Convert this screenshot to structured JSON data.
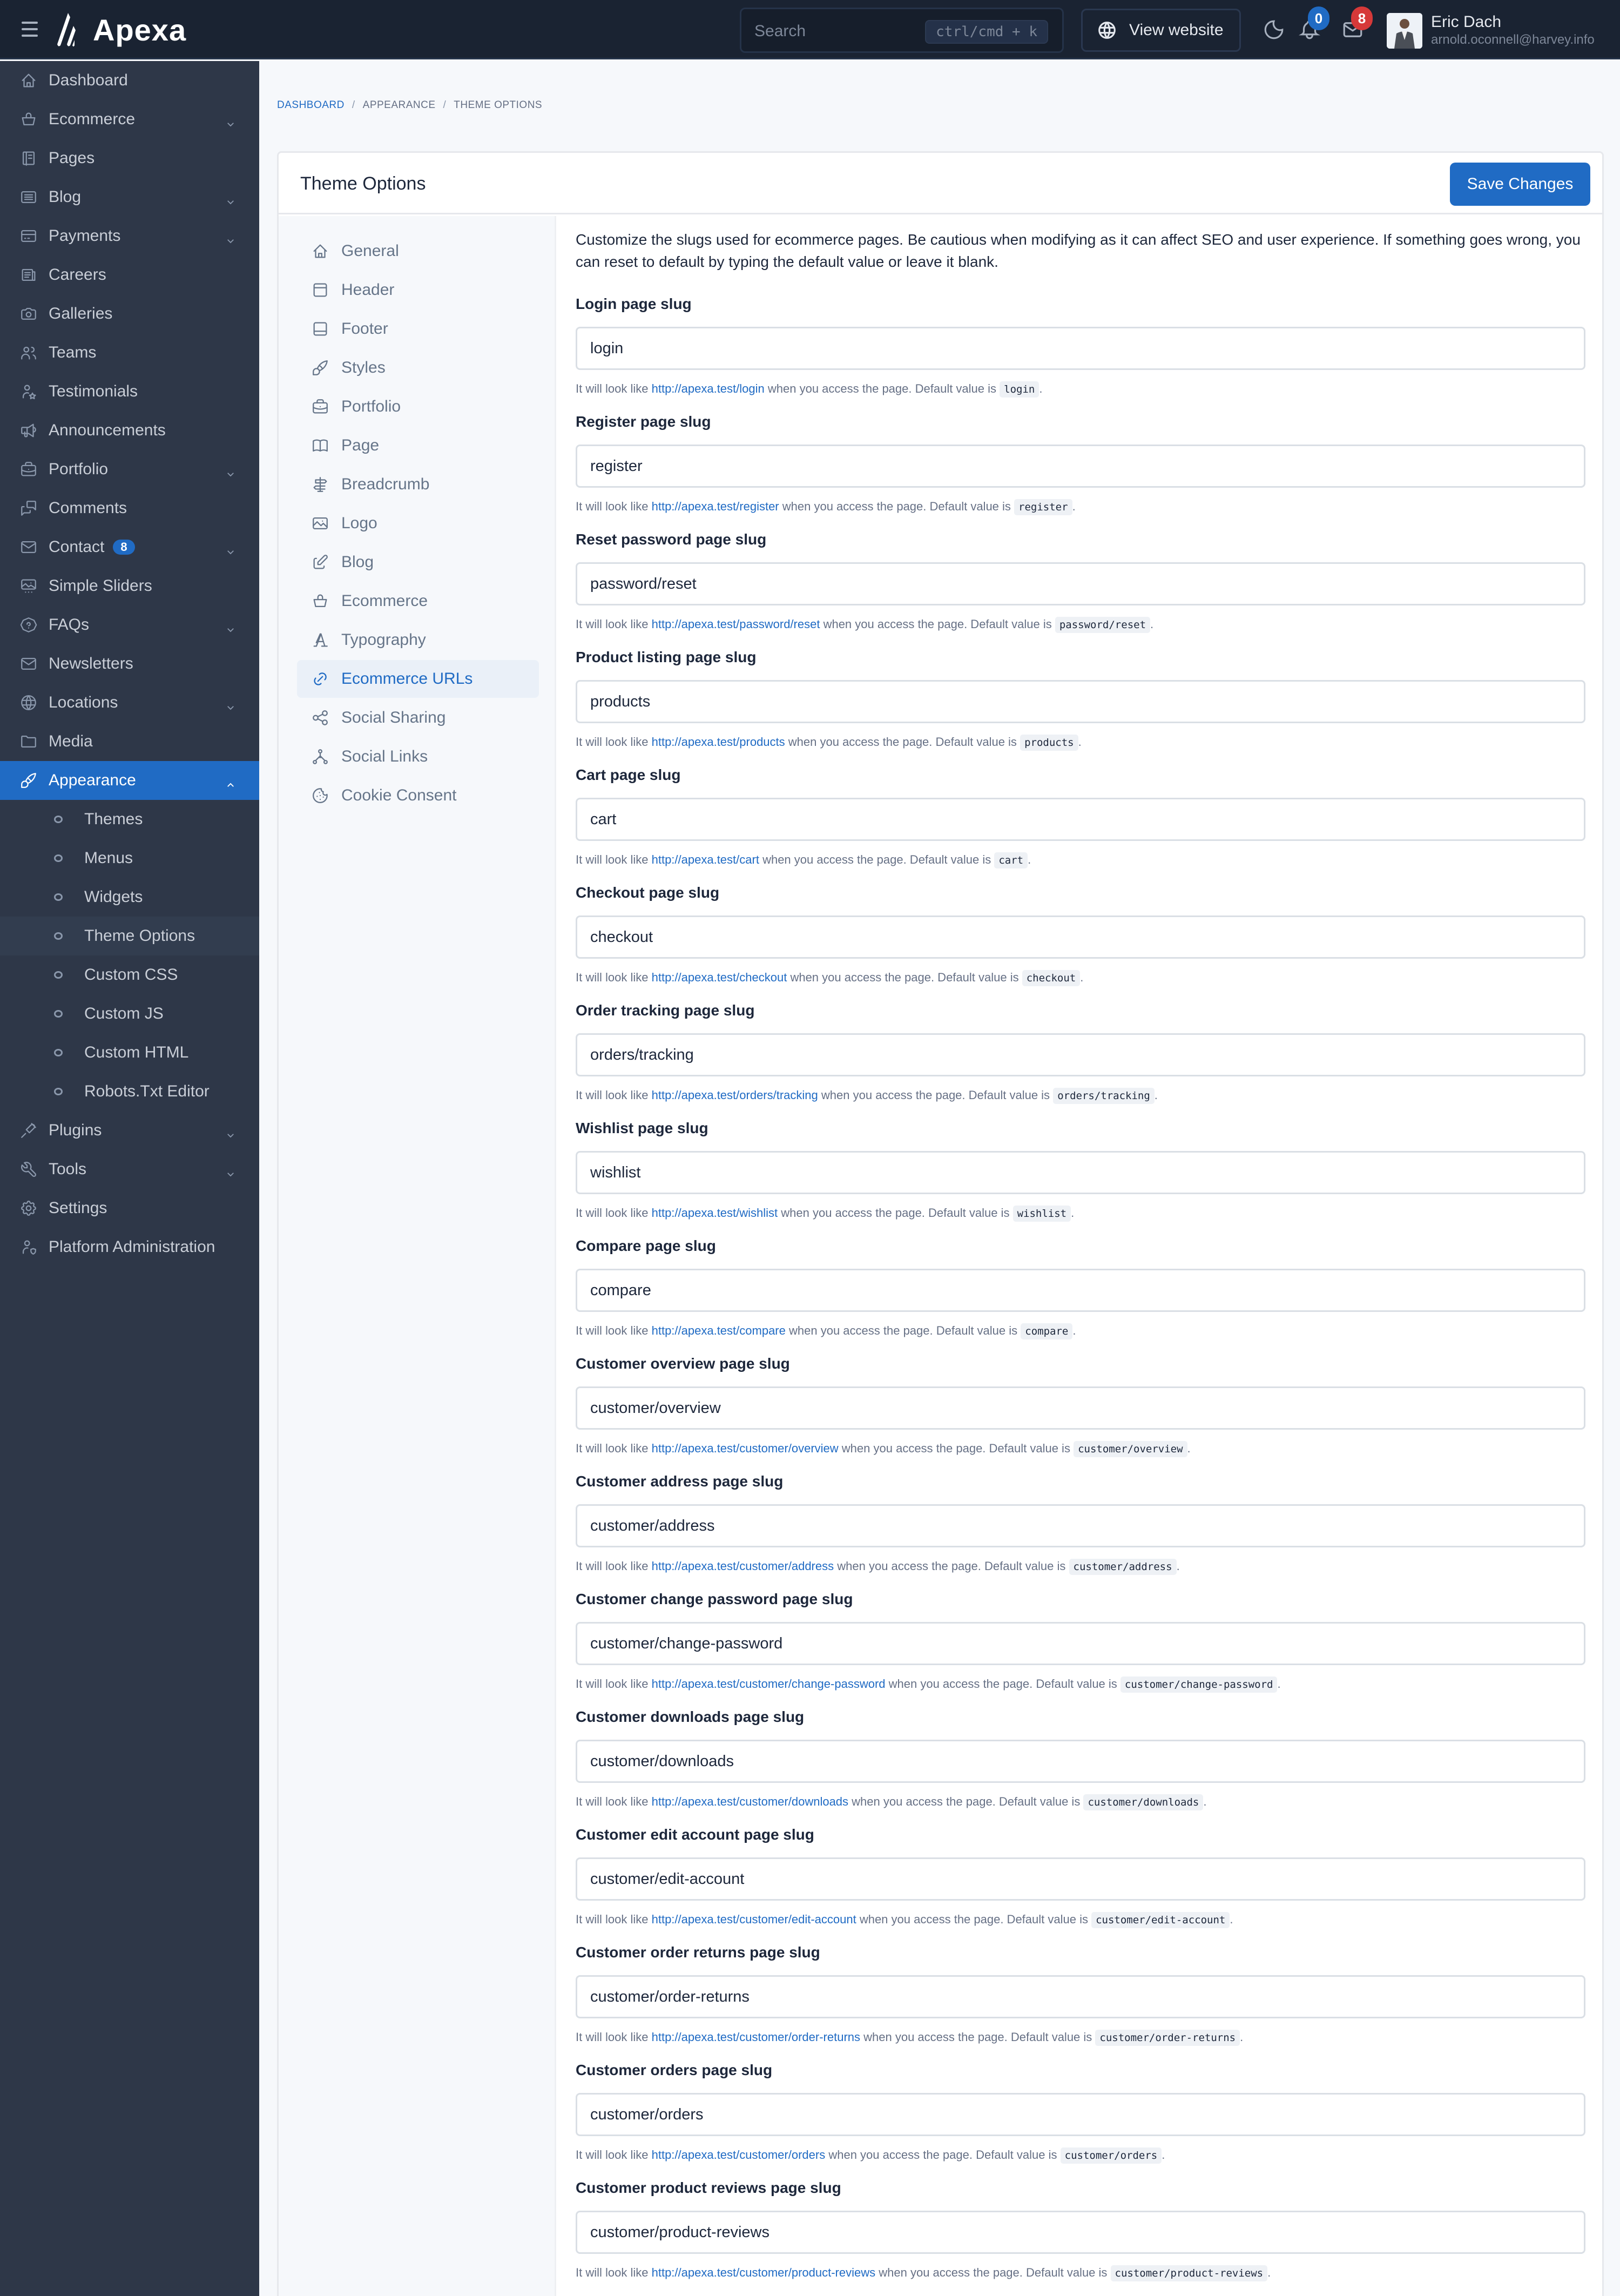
{
  "app": {
    "name": "Apexa",
    "search_placeholder": "Search",
    "search_shortcut": "ctrl/cmd + k",
    "view_website_label": "View website",
    "notifications_count": "0",
    "messages_count": "8",
    "user": {
      "name": "Eric Dach",
      "email": "arnold.oconnell@harvey.info"
    },
    "colors": {
      "primary": "#206bc4",
      "topbar": "#1a2332",
      "sidebar": "#2e3748",
      "danger": "#d63939"
    }
  },
  "sidebar": {
    "items": [
      {
        "label": "Dashboard",
        "icon": "home-icon",
        "has_children": false
      },
      {
        "label": "Ecommerce",
        "icon": "basket-icon",
        "has_children": true
      },
      {
        "label": "Pages",
        "icon": "notebook-icon",
        "has_children": false
      },
      {
        "label": "Blog",
        "icon": "article-icon",
        "has_children": true
      },
      {
        "label": "Payments",
        "icon": "credit-card-icon",
        "has_children": true
      },
      {
        "label": "Careers",
        "icon": "news-icon",
        "has_children": false
      },
      {
        "label": "Galleries",
        "icon": "camera-icon",
        "has_children": false
      },
      {
        "label": "Teams",
        "icon": "users-icon",
        "has_children": false
      },
      {
        "label": "Testimonials",
        "icon": "user-star-icon",
        "has_children": false
      },
      {
        "label": "Announcements",
        "icon": "speakerphone-icon",
        "has_children": false
      },
      {
        "label": "Portfolio",
        "icon": "briefcase-icon",
        "has_children": true
      },
      {
        "label": "Comments",
        "icon": "messages-icon",
        "has_children": false
      },
      {
        "label": "Contact",
        "icon": "mail-icon",
        "has_children": true,
        "badge": "8"
      },
      {
        "label": "Simple Sliders",
        "icon": "slideshow-icon",
        "has_children": false
      },
      {
        "label": "FAQs",
        "icon": "help-octagon-icon",
        "has_children": true
      },
      {
        "label": "Newsletters",
        "icon": "mail-icon",
        "has_children": false
      },
      {
        "label": "Locations",
        "icon": "world-icon",
        "has_children": true
      },
      {
        "label": "Media",
        "icon": "folder-icon",
        "has_children": false
      },
      {
        "label": "Appearance",
        "icon": "brush-icon",
        "has_children": true,
        "active": true,
        "children": [
          "Themes",
          "Menus",
          "Widgets",
          "Theme Options",
          "Custom CSS",
          "Custom JS",
          "Custom HTML",
          "Robots.Txt Editor"
        ],
        "current_child": "Theme Options"
      },
      {
        "label": "Plugins",
        "icon": "plug-icon",
        "has_children": true
      },
      {
        "label": "Tools",
        "icon": "tool-icon",
        "has_children": true
      },
      {
        "label": "Settings",
        "icon": "settings-icon",
        "has_children": false
      },
      {
        "label": "Platform Administration",
        "icon": "user-shield-icon",
        "has_children": false
      }
    ]
  },
  "breadcrumb": [
    "DASHBOARD",
    "APPEARANCE",
    "THEME OPTIONS"
  ],
  "page": {
    "title": "Theme Options",
    "save_label": "Save Changes"
  },
  "options_nav": [
    {
      "label": "General",
      "icon": "home-icon"
    },
    {
      "label": "Header",
      "icon": "header-layout-icon"
    },
    {
      "label": "Footer",
      "icon": "footer-layout-icon"
    },
    {
      "label": "Styles",
      "icon": "brush-icon"
    },
    {
      "label": "Portfolio",
      "icon": "briefcase-icon"
    },
    {
      "label": "Page",
      "icon": "book-icon"
    },
    {
      "label": "Breadcrumb",
      "icon": "signpost-icon"
    },
    {
      "label": "Logo",
      "icon": "photo-icon"
    },
    {
      "label": "Blog",
      "icon": "edit-icon"
    },
    {
      "label": "Ecommerce",
      "icon": "basket-icon"
    },
    {
      "label": "Typography",
      "icon": "typography-icon"
    },
    {
      "label": "Ecommerce URLs",
      "icon": "link-icon",
      "active": true
    },
    {
      "label": "Social Sharing",
      "icon": "share-icon"
    },
    {
      "label": "Social Links",
      "icon": "affiliate-icon"
    },
    {
      "label": "Cookie Consent",
      "icon": "cookie-icon"
    }
  ],
  "form": {
    "intro": "Customize the slugs used for ecommerce pages. Be cautious when modifying as it can affect SEO and user experience. If something goes wrong, you can reset to default by typing the default value or leave it blank.",
    "hint_prefix": "It will look like",
    "hint_middle": "when you access the page. Default value is",
    "base_url": "http://apexa.test/",
    "fields": [
      {
        "label": "Login page slug",
        "value": "login",
        "default": "login"
      },
      {
        "label": "Register page slug",
        "value": "register",
        "default": "register"
      },
      {
        "label": "Reset password page slug",
        "value": "password/reset",
        "default": "password/reset"
      },
      {
        "label": "Product listing page slug",
        "value": "products",
        "default": "products"
      },
      {
        "label": "Cart page slug",
        "value": "cart",
        "default": "cart"
      },
      {
        "label": "Checkout page slug",
        "value": "checkout",
        "default": "checkout"
      },
      {
        "label": "Order tracking page slug",
        "value": "orders/tracking",
        "default": "orders/tracking"
      },
      {
        "label": "Wishlist page slug",
        "value": "wishlist",
        "default": "wishlist"
      },
      {
        "label": "Compare page slug",
        "value": "compare",
        "default": "compare"
      },
      {
        "label": "Customer overview page slug",
        "value": "customer/overview",
        "default": "customer/overview"
      },
      {
        "label": "Customer address page slug",
        "value": "customer/address",
        "default": "customer/address"
      },
      {
        "label": "Customer change password page slug",
        "value": "customer/change-password",
        "default": "customer/change-password"
      },
      {
        "label": "Customer downloads page slug",
        "value": "customer/downloads",
        "default": "customer/downloads"
      },
      {
        "label": "Customer edit account page slug",
        "value": "customer/edit-account",
        "default": "customer/edit-account"
      },
      {
        "label": "Customer order returns page slug",
        "value": "customer/order-returns",
        "default": "customer/order-returns"
      },
      {
        "label": "Customer orders page slug",
        "value": "customer/orders",
        "default": "customer/orders"
      },
      {
        "label": "Customer product reviews page slug",
        "value": "customer/product-reviews",
        "default": "customer/product-reviews"
      }
    ]
  }
}
